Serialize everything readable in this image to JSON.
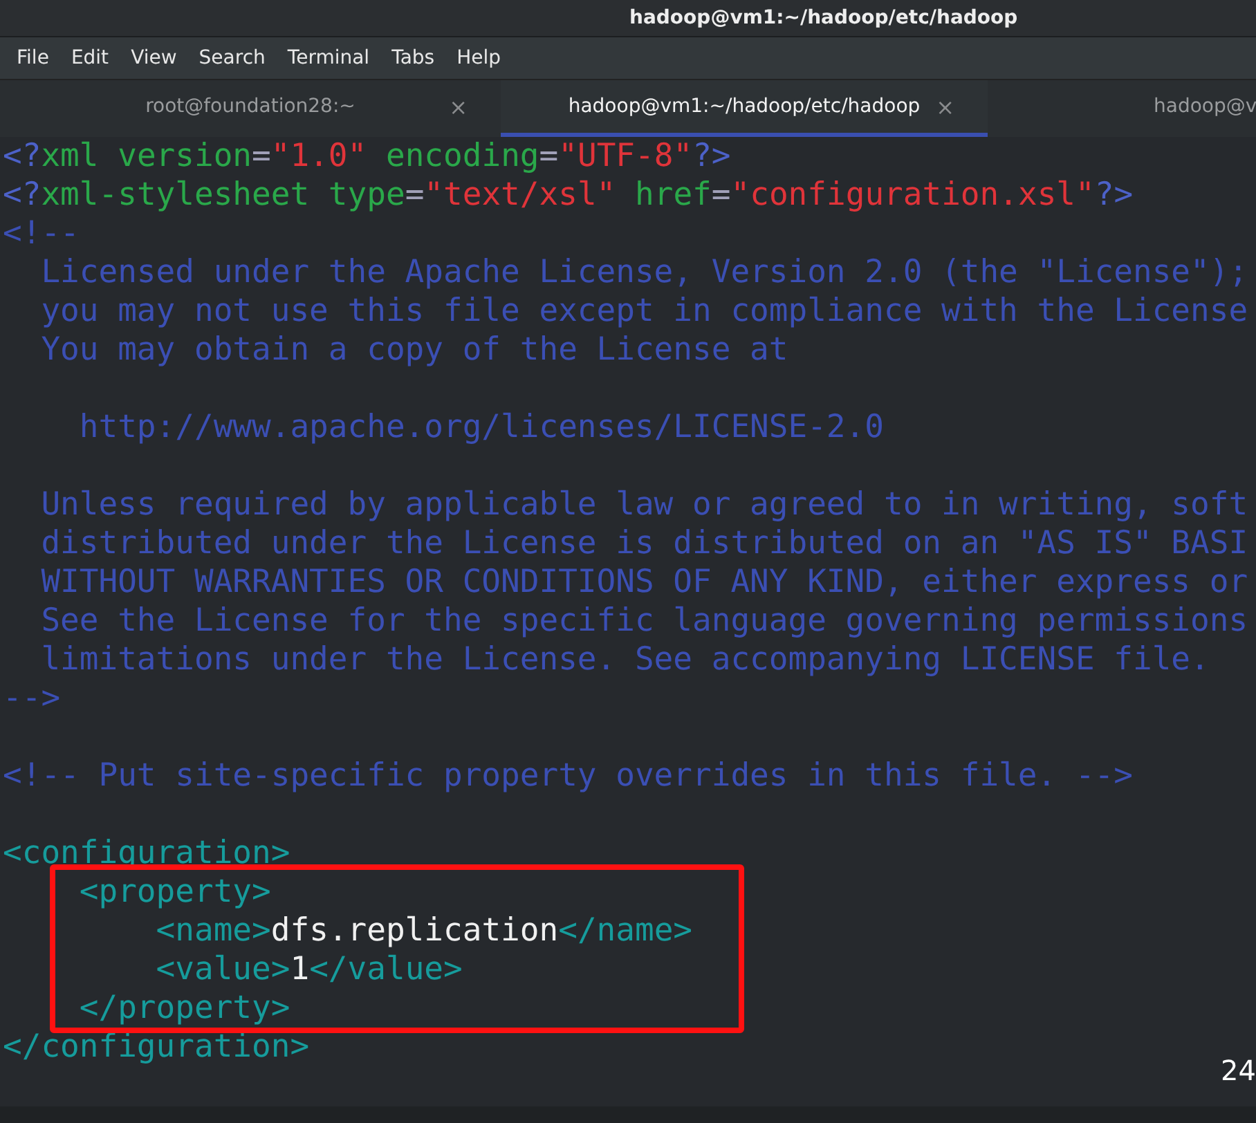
{
  "window": {
    "title": "hadoop@vm1:~/hadoop/etc/hadoop"
  },
  "menu": [
    "File",
    "Edit",
    "View",
    "Search",
    "Terminal",
    "Tabs",
    "Help"
  ],
  "tabs": [
    {
      "label": "root@foundation28:~",
      "close": "×",
      "selected": false
    },
    {
      "label": "hadoop@vm1:~/hadoop/etc/hadoop",
      "close": "×",
      "selected": true
    },
    {
      "label": "hadoop@v",
      "selected": false
    }
  ],
  "editor": {
    "lines": [
      {
        "highlighted": false,
        "segments": [
          {
            "kind": "punct",
            "text": "<?"
          },
          {
            "kind": "attr",
            "text": "xml version"
          },
          {
            "kind": "plain",
            "text": "="
          },
          {
            "kind": "value",
            "text": "\"1.0\""
          },
          {
            "kind": "attr",
            "text": " encoding"
          },
          {
            "kind": "plain",
            "text": "="
          },
          {
            "kind": "value",
            "text": "\"UTF-8\""
          },
          {
            "kind": "punct",
            "text": "?>"
          }
        ]
      },
      {
        "highlighted": false,
        "segments": [
          {
            "kind": "punct",
            "text": "<?"
          },
          {
            "kind": "attr",
            "text": "xml-stylesheet type"
          },
          {
            "kind": "plain",
            "text": "="
          },
          {
            "kind": "value",
            "text": "\"text/xsl\""
          },
          {
            "kind": "attr",
            "text": " href"
          },
          {
            "kind": "plain",
            "text": "="
          },
          {
            "kind": "value",
            "text": "\"configuration.xsl\""
          },
          {
            "kind": "punct",
            "text": "?>"
          }
        ]
      },
      {
        "highlighted": false,
        "segments": [
          {
            "kind": "comment",
            "text": "<!--"
          }
        ]
      },
      {
        "highlighted": false,
        "segments": [
          {
            "kind": "comment",
            "text": "  Licensed under the Apache License, Version 2.0 (the \"License\");"
          }
        ]
      },
      {
        "highlighted": false,
        "segments": [
          {
            "kind": "comment",
            "text": "  you may not use this file except in compliance with the License"
          }
        ]
      },
      {
        "highlighted": false,
        "segments": [
          {
            "kind": "comment",
            "text": "  You may obtain a copy of the License at"
          }
        ]
      },
      {
        "kind": "blank"
      },
      {
        "highlighted": false,
        "segments": [
          {
            "kind": "comment",
            "text": "    http://www.apache.org/licenses/LICENSE-2.0"
          }
        ]
      },
      {
        "kind": "blank"
      },
      {
        "highlighted": false,
        "segments": [
          {
            "kind": "comment",
            "text": "  Unless required by applicable law or agreed to in writing, soft"
          }
        ]
      },
      {
        "highlighted": false,
        "segments": [
          {
            "kind": "comment",
            "text": "  distributed under the License is distributed on an \"AS IS\" BASI"
          }
        ]
      },
      {
        "highlighted": false,
        "segments": [
          {
            "kind": "comment",
            "text": "  WITHOUT WARRANTIES OR CONDITIONS OF ANY KIND, either express or"
          }
        ]
      },
      {
        "highlighted": false,
        "segments": [
          {
            "kind": "comment",
            "text": "  See the License for the specific language governing permissions"
          }
        ]
      },
      {
        "highlighted": false,
        "segments": [
          {
            "kind": "comment",
            "text": "  limitations under the License. See accompanying LICENSE file."
          }
        ]
      },
      {
        "highlighted": false,
        "segments": [
          {
            "kind": "comment",
            "text": "-->"
          }
        ]
      },
      {
        "kind": "blank"
      },
      {
        "highlighted": false,
        "segments": [
          {
            "kind": "comment",
            "text": "<!-- Put site-specific property overrides in this file. -->"
          }
        ]
      },
      {
        "kind": "blank"
      },
      {
        "highlighted": false,
        "segments": [
          {
            "kind": "tag",
            "text": "<configuration>"
          }
        ]
      },
      {
        "highlighted": true,
        "segments": [
          {
            "kind": "tag",
            "text": "    <property>"
          }
        ]
      },
      {
        "highlighted": true,
        "segments": [
          {
            "kind": "tag",
            "text": "        <name>"
          },
          {
            "kind": "text",
            "text": "dfs.replication"
          },
          {
            "kind": "tag",
            "text": "</name>"
          }
        ]
      },
      {
        "highlighted": true,
        "segments": [
          {
            "kind": "tag",
            "text": "        <value>"
          },
          {
            "kind": "text",
            "text": "1"
          },
          {
            "kind": "tag",
            "text": "</value>"
          }
        ]
      },
      {
        "highlighted": true,
        "segments": [
          {
            "kind": "tag",
            "text": "    </property>"
          }
        ]
      },
      {
        "highlighted": false,
        "segments": [
          {
            "kind": "tag",
            "text": "</configuration>"
          }
        ]
      }
    ]
  },
  "corner_text": "24"
}
